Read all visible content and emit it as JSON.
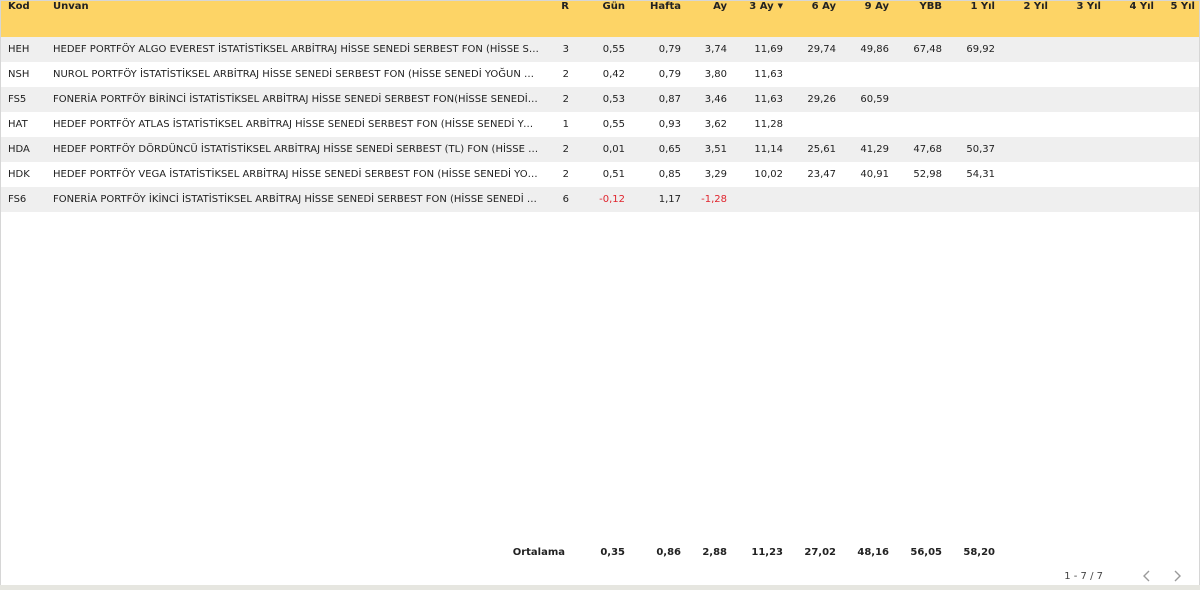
{
  "columns": [
    "Kod",
    "Ünvan",
    "R",
    "Gün",
    "Hafta",
    "Ay",
    "3 Ay",
    "6 Ay",
    "9 Ay",
    "YBB",
    "1 Yıl",
    "2 Yıl",
    "3 Yıl",
    "4 Yıl",
    "5 Yıl"
  ],
  "sort_column": "3 Ay",
  "sort_icon": "sort-down-icon",
  "negative_color": "#e0252e",
  "header_color": "#fdd466",
  "rows": [
    [
      "HEH",
      "HEDEF PORTFÖY ALGO EVEREST İSTATİSTİKSEL ARBİTRAJ HİSSE SENEDİ SERBEST FON (HİSSE SENEDİ YOĞUN FON)",
      "3",
      "0,55",
      "0,79",
      "3,74",
      "11,69",
      "29,74",
      "49,86",
      "67,48",
      "69,92",
      "",
      "",
      "",
      ""
    ],
    [
      "NSH",
      "NUROL PORTFÖY İSTATİSTİKSEL ARBİTRAJ HİSSE SENEDİ SERBEST FON (HİSSE SENEDİ YOĞUN FON)",
      "2",
      "0,42",
      "0,79",
      "3,80",
      "11,63",
      "",
      "",
      "",
      "",
      "",
      "",
      "",
      ""
    ],
    [
      "FS5",
      "FONERİA PORTFÖY BİRİNCİ İSTATİSTİKSEL ARBİTRAJ HİSSE SENEDİ SERBEST FON(HİSSE SENEDİ YOĞUN FON)",
      "2",
      "0,53",
      "0,87",
      "3,46",
      "11,63",
      "29,26",
      "60,59",
      "",
      "",
      "",
      "",
      "",
      ""
    ],
    [
      "HAT",
      "HEDEF PORTFÖY ATLAS İSTATİSTİKSEL ARBİTRAJ HİSSE SENEDİ SERBEST FON (HİSSE SENEDİ YOĞUN FON)",
      "1",
      "0,55",
      "0,93",
      "3,62",
      "11,28",
      "",
      "",
      "",
      "",
      "",
      "",
      "",
      ""
    ],
    [
      "HDA",
      "HEDEF PORTFÖY DÖRDÜNCÜ İSTATİSTİKSEL ARBİTRAJ HİSSE SENEDİ SERBEST (TL) FON (HİSSE SENEDİ YOĞUN FON)",
      "2",
      "0,01",
      "0,65",
      "3,51",
      "11,14",
      "25,61",
      "41,29",
      "47,68",
      "50,37",
      "",
      "",
      "",
      ""
    ],
    [
      "HDK",
      "HEDEF PORTFÖY VEGA İSTATİSTİKSEL ARBİTRAJ HİSSE SENEDİ SERBEST FON (HİSSE SENEDİ YOĞUN FON)",
      "2",
      "0,51",
      "0,85",
      "3,29",
      "10,02",
      "23,47",
      "40,91",
      "52,98",
      "54,31",
      "",
      "",
      "",
      ""
    ],
    [
      "FS6",
      "FONERİA PORTFÖY İKİNCİ İSTATİSTİKSEL ARBİTRAJ HİSSE SENEDİ SERBEST FON (HİSSE SENEDİ YOĞUN FON)",
      "6",
      "-0,12",
      "1,17",
      "-1,28",
      "",
      "",
      "",
      "",
      "",
      "",
      "",
      "",
      ""
    ]
  ],
  "average": {
    "label": "Ortalama",
    "values": [
      "0,35",
      "0,86",
      "2,88",
      "11,23",
      "27,02",
      "48,16",
      "56,05",
      "58,20"
    ]
  },
  "pagination": {
    "range": "1 - 7 / 7",
    "prev_icon": "chevron-left-icon",
    "next_icon": "chevron-right-icon"
  }
}
